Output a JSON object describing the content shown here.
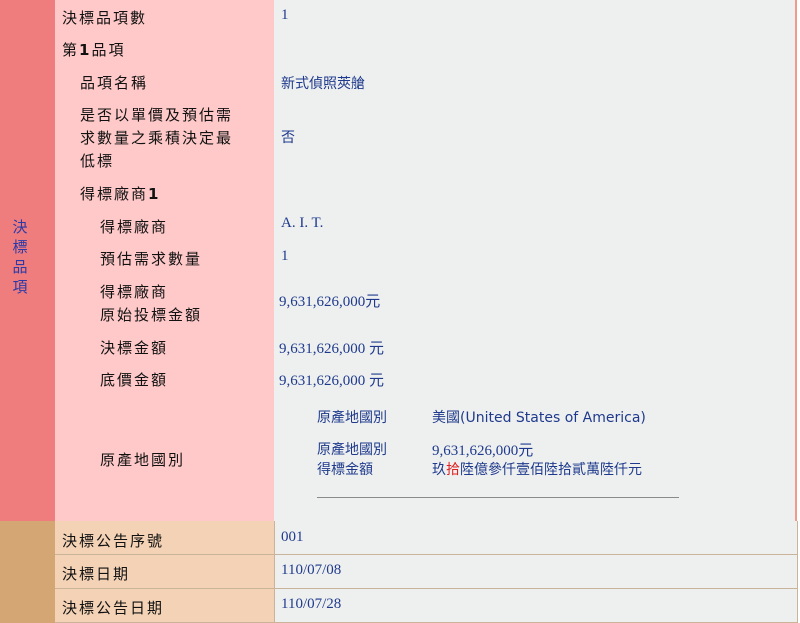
{
  "section": {
    "label": "決標品項"
  },
  "fields": {
    "item_count": {
      "label": "決標品項數",
      "value": "1"
    },
    "item_heading": {
      "prefix": "第",
      "num": "1",
      "suffix": "品項"
    },
    "item_name": {
      "label": "品項名稱",
      "value": "新式偵照莢艙"
    },
    "unit_price_rule": {
      "label_lines": [
        "是否以單價及預估需",
        "求數量之乘積決定最",
        "低標"
      ],
      "value": "否"
    },
    "winner_heading": {
      "prefix": "得標廠商",
      "num": "1"
    },
    "winner": {
      "label": "得標廠商",
      "value": "A. I. T."
    },
    "est_qty": {
      "label": "預估需求數量",
      "value": "1"
    },
    "orig_bid": {
      "label_lines": [
        "得標廠商",
        "原始投標金額"
      ],
      "value": "9,631,626,000元"
    },
    "award_amount": {
      "label": "決標金額",
      "value": "9,631,626,000 元"
    },
    "floor_price": {
      "label": "底價金額",
      "value": "9,631,626,000 元"
    },
    "origin": {
      "label": "原產地國別",
      "country_label": "原產地國別",
      "country_value": "美國(United States of America)",
      "amount_label_1": "原產地國別",
      "amount_label_2": "得標金額",
      "amount_value": "9,631,626,000元",
      "amount_text_pre": "玖",
      "amount_text_red": "拾",
      "amount_text_post": "陸億參仟壹佰陸拾貳萬陸仟元"
    }
  },
  "bottom": {
    "notice_no": {
      "label": "決標公告序號",
      "value": "001"
    },
    "award_date": {
      "label": "決標日期",
      "value": "110/07/08"
    },
    "notice_date": {
      "label": "決標公告日期",
      "value": "110/07/28"
    }
  },
  "colors": {
    "section_bg": "#f07d7d",
    "label_bg": "#ffc9c9",
    "value_bg": "#eef0f0",
    "bottom_left": "#d4a673",
    "bottom_label": "#f3d2b6",
    "value_text": "#1f3a8c"
  }
}
